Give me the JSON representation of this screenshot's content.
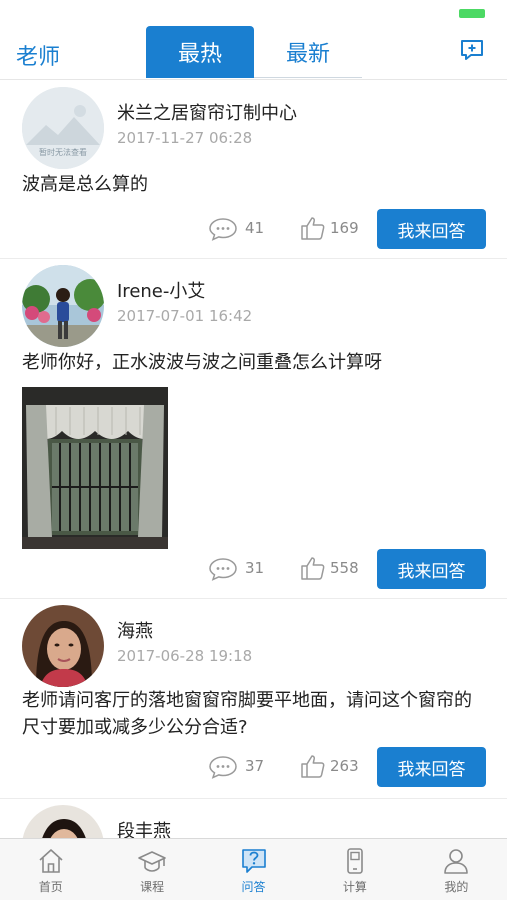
{
  "header": {
    "left_label": "老师",
    "tab_hot": "最热",
    "tab_new": "最新",
    "right_icon": "add-comment-icon"
  },
  "posts": [
    {
      "name": "米兰之居窗帘订制中心",
      "time": "2017-11-27 06:28",
      "question": "波高是总么算的",
      "avatar_text": "暂时无法查看",
      "comments": "41",
      "likes": "169",
      "answer_label": "我来回答"
    },
    {
      "name": "Irene-小艾",
      "time": "2017-07-01 16:42",
      "question": "老师你好，正水波波与波之间重叠怎么计算呀",
      "comments": "31",
      "likes": "558",
      "answer_label": "我来回答"
    },
    {
      "name": "海燕",
      "time": "2017-06-28 19:18",
      "question": "老师请问客厅的落地窗窗帘脚要平地面，请问这个窗帘的尺寸要加或减多少公分合适?",
      "comments": "37",
      "likes": "263",
      "answer_label": "我来回答"
    },
    {
      "name": "段丰燕"
    }
  ],
  "tabbar": [
    {
      "label": "首页",
      "icon": "home-icon"
    },
    {
      "label": "课程",
      "icon": "graduation-cap-icon"
    },
    {
      "label": "问答",
      "icon": "question-icon"
    },
    {
      "label": "计算",
      "icon": "calculator-icon"
    },
    {
      "label": "我的",
      "icon": "user-icon"
    }
  ],
  "colors": {
    "accent": "#1a7fd0",
    "battery": "#4cd964"
  }
}
